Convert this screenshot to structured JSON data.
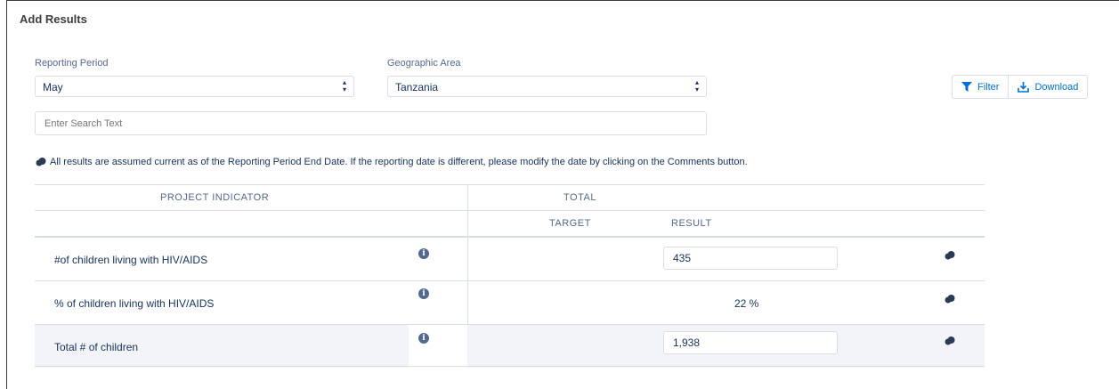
{
  "page": {
    "title": "Add Results"
  },
  "filters": {
    "reporting_period": {
      "label": "Reporting Period",
      "value": "May"
    },
    "geographic_area": {
      "label": "Geographic Area",
      "value": "Tanzania"
    },
    "search": {
      "placeholder": "Enter Search Text"
    }
  },
  "toolbar": {
    "filter_label": "Filter",
    "download_label": "Download"
  },
  "notice": "All results are assumed current as of the Reporting Period End Date. If the reporting date is different, please modify the date by clicking on the Comments button.",
  "table": {
    "headers": {
      "project_indicator": "PROJECT INDICATOR",
      "total": "TOTAL",
      "target": "TARGET",
      "result": "RESULT"
    },
    "rows": [
      {
        "indicator": "#of children living with HIV/AIDS",
        "result": "435",
        "editable": true
      },
      {
        "indicator": "% of children living with HIV/AIDS",
        "result": "22 %",
        "editable": false
      },
      {
        "indicator": "Total # of children",
        "result": "1,938",
        "editable": true
      }
    ]
  },
  "icons": {
    "info": "info-icon",
    "comment": "comment-icon",
    "filter": "filter-icon",
    "download": "download-icon"
  },
  "colors": {
    "accent": "#0070d2",
    "text": "#16325c",
    "muted": "#54698d",
    "border": "#d8dde6",
    "row_shade": "#f3f4f7"
  }
}
